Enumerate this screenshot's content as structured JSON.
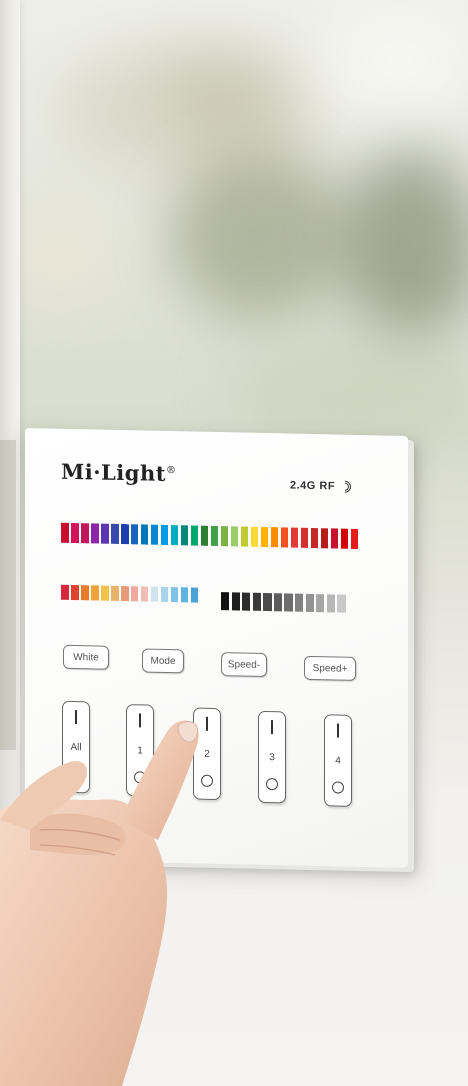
{
  "brand": {
    "name": "Mi·Light",
    "registered": "®",
    "rf_label": "2.4G RF"
  },
  "colors": {
    "rainbow": [
      "#c8102e",
      "#d4145a",
      "#c2185b",
      "#8e24aa",
      "#5e35b1",
      "#3949ab",
      "#1e40af",
      "#1565c0",
      "#0277bd",
      "#0288d1",
      "#039be5",
      "#00acc1",
      "#00897b",
      "#00a86b",
      "#2e7d32",
      "#43a047",
      "#7cb342",
      "#9ccc65",
      "#c0ca33",
      "#fdd835",
      "#ffb300",
      "#fb8c00",
      "#f4511e",
      "#e53935",
      "#d32f2f",
      "#c62828",
      "#b71c1c",
      "#c8102e",
      "#d50000",
      "#e21b1b"
    ],
    "temp": [
      "#d7263d",
      "#e0442f",
      "#e87a2a",
      "#f0a23b",
      "#f3c14a",
      "#e7b36a",
      "#e89a78",
      "#efa9a0",
      "#f2bcb6",
      "#cfe3ee",
      "#a8d4ec",
      "#7fc2e6",
      "#5fb3df",
      "#4aa3d6"
    ],
    "gray": [
      "#111",
      "#1e1e1e",
      "#2c2c2c",
      "#3a3a3a",
      "#4b4b4b",
      "#5c5c5c",
      "#6e6e6e",
      "#808080",
      "#929292",
      "#a5a5a5",
      "#b7b7b7",
      "#c9c9c9"
    ]
  },
  "buttons": [
    {
      "label": "White"
    },
    {
      "label": "Mode"
    },
    {
      "label": "Speed-"
    },
    {
      "label": "Speed+"
    }
  ],
  "zones": [
    {
      "label": "All"
    },
    {
      "label": "1"
    },
    {
      "label": "2"
    },
    {
      "label": "3"
    },
    {
      "label": "4"
    }
  ]
}
